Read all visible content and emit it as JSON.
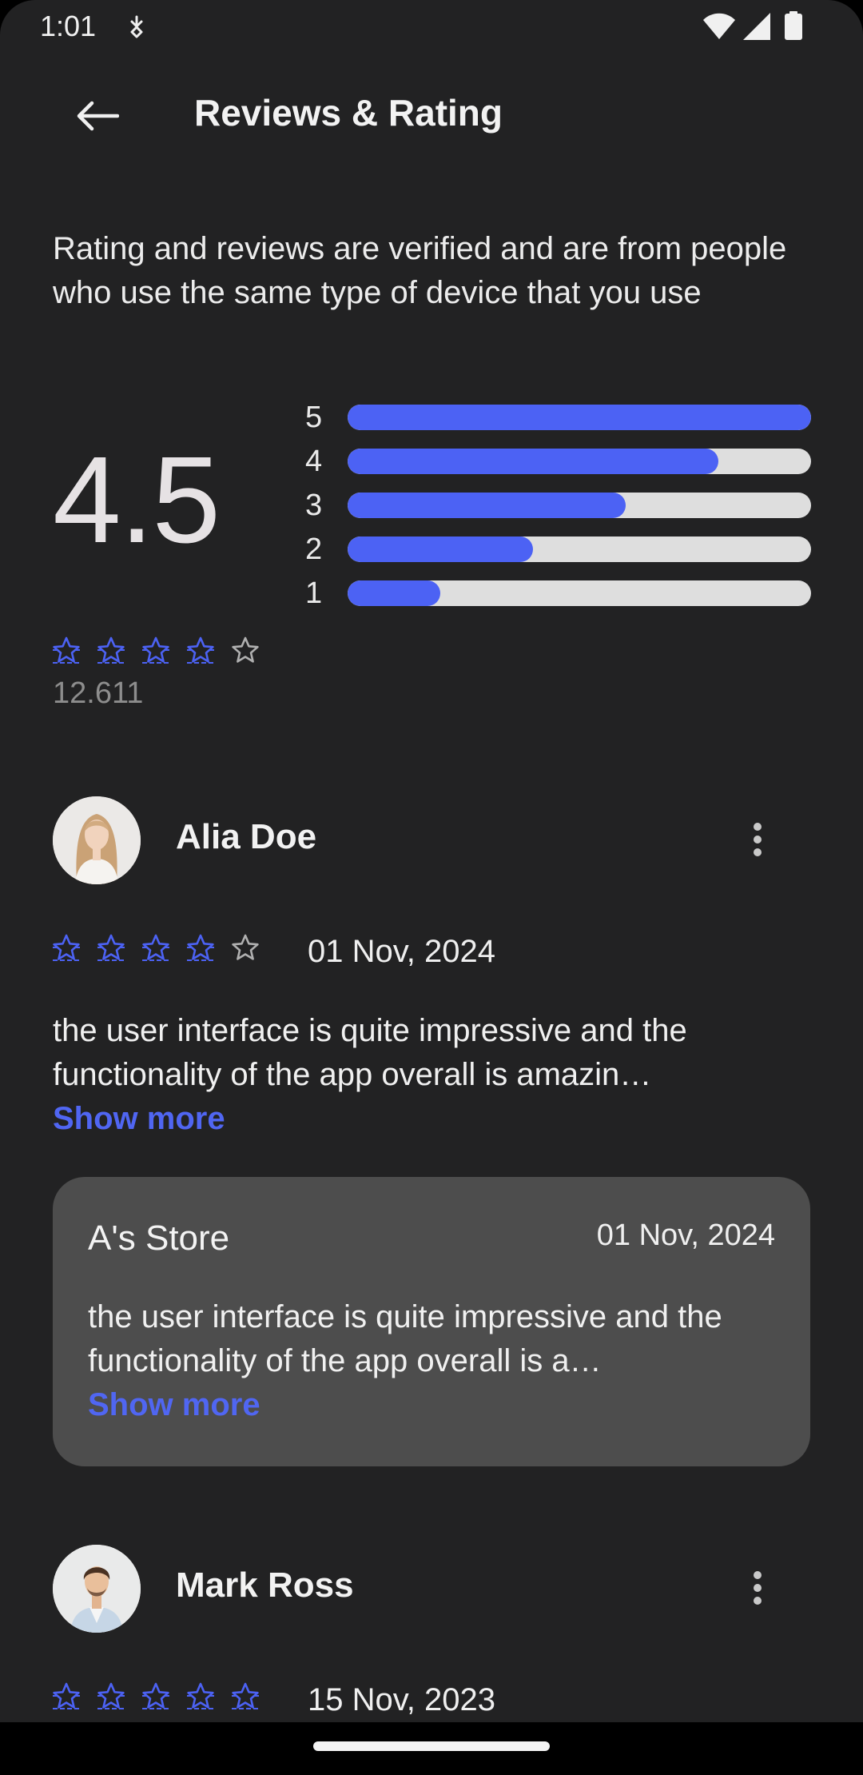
{
  "status_bar": {
    "time": "1:01"
  },
  "header": {
    "title": "Reviews & Rating"
  },
  "intro": "Rating and reviews are verified and are from people who use the same type of device that you use",
  "summary": {
    "average": "4.5",
    "count": "12.611",
    "stars_filled": 4,
    "distribution": [
      {
        "label": "5",
        "fraction": 1.0
      },
      {
        "label": "4",
        "fraction": 0.8
      },
      {
        "label": "3",
        "fraction": 0.6
      },
      {
        "label": "2",
        "fraction": 0.4
      },
      {
        "label": "1",
        "fraction": 0.2
      }
    ]
  },
  "reviews": [
    {
      "name": "Alia Doe",
      "date": "01 Nov, 2024",
      "stars_filled": 4,
      "text": "the user interface is quite impressive and the functionality of the app overall is amazin…",
      "show_more": "Show more",
      "reply": {
        "store": "A's Store",
        "date": "01 Nov, 2024",
        "text": "the user interface is quite impressive and the functionality of the app overall is a…",
        "show_more": "Show more"
      }
    },
    {
      "name": "Mark Ross",
      "date": "15 Nov, 2023",
      "stars_filled": 5
    }
  ],
  "colors": {
    "accent": "#4c62f4",
    "background": "#222223",
    "track": "#dedede",
    "reply_card": "#4d4d4d",
    "star_empty": "#b0b0b0"
  }
}
